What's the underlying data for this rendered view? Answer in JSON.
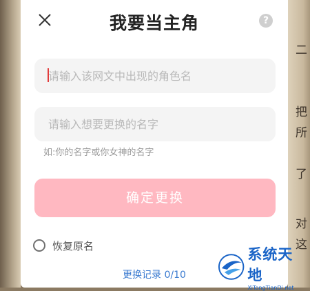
{
  "background": {
    "chars": [
      "二",
      "把",
      "所",
      "了",
      "对",
      "这"
    ]
  },
  "dialog": {
    "title": "我要当主角",
    "help_label": "?",
    "role_input": {
      "value": "",
      "placeholder": "请输入该网文中出现的角色名"
    },
    "name_input": {
      "value": "",
      "placeholder": "请输入想要更换的名字"
    },
    "hint": "如:你的名字或你女神的名字",
    "confirm_label": "确定更换",
    "restore_label": "恢复原名",
    "history_link": "更换记录 0/10"
  },
  "colors": {
    "confirm_button": "#ffb8c1",
    "link": "#3b7bd0",
    "input_bg": "#f4f4f4",
    "caret": "#e23c3c"
  },
  "watermark": {
    "brand_cn": "系统天地",
    "brand_en": "XiTongTianDi.net"
  }
}
